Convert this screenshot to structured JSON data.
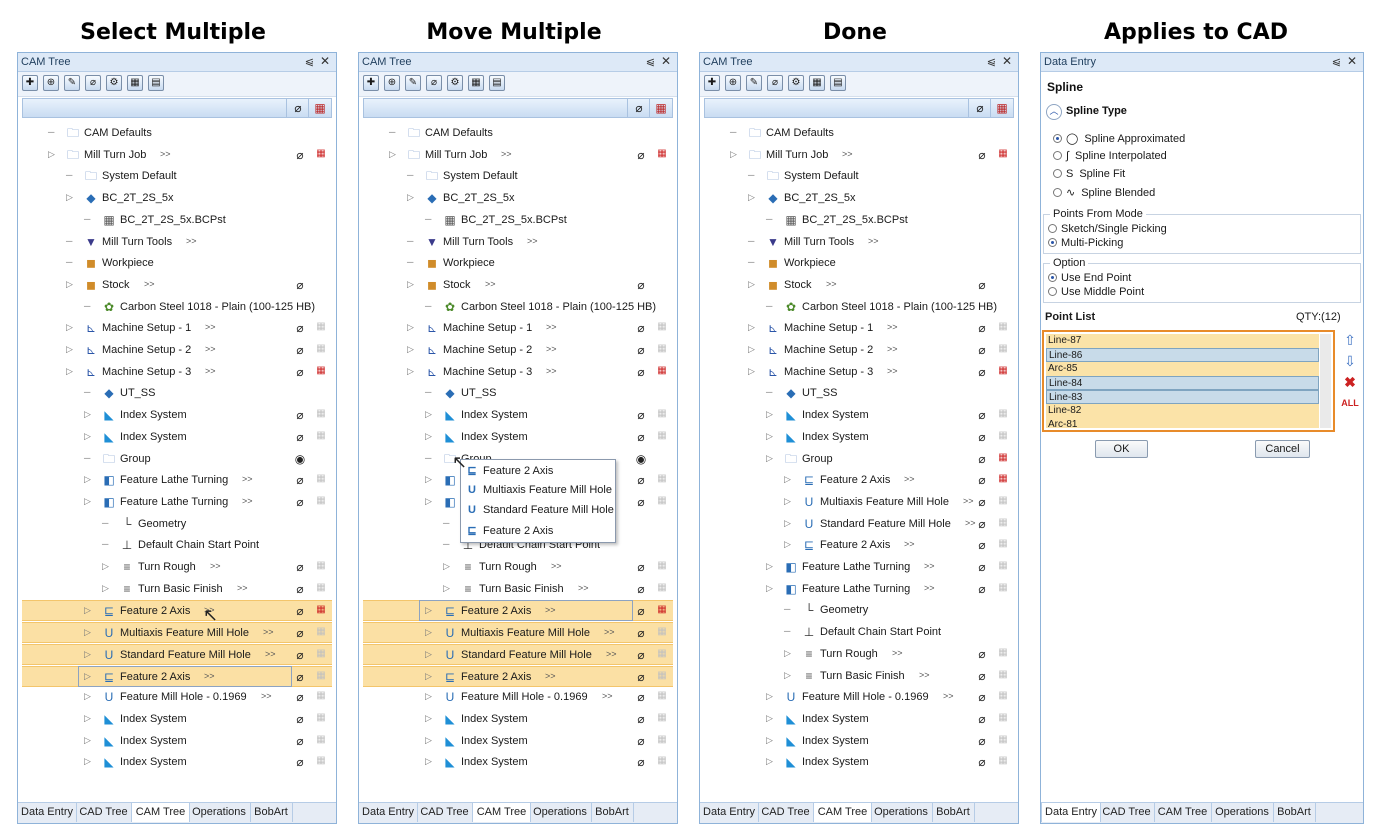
{
  "titles": {
    "p1": "Select Multiple",
    "p2": "Move Multiple",
    "p3": "Done",
    "p4": "Applies to CAD"
  },
  "window": {
    "cam_title": "CAM Tree",
    "pin": "⩿",
    "close": "✕"
  },
  "tabs": [
    "Data Entry",
    "CAD Tree",
    "CAM Tree",
    "Operations",
    "BobArt"
  ],
  "popup": {
    "items": [
      "Feature 2 Axis",
      "Multiaxis Feature Mill Hole",
      "Standard Feature Mill Hole",
      "Feature 2 Axis"
    ]
  },
  "tree1": [
    "CAM Defaults",
    "Mill Turn Job",
    "System Default",
    "BC_2T_2S_5x",
    "BC_2T_2S_5x.BCPst",
    "Mill Turn Tools",
    "Workpiece",
    "Stock",
    "Carbon Steel 1018 - Plain (100-125 HB)",
    "Machine Setup - 1",
    "Machine Setup - 2",
    "Machine Setup - 3",
    "UT_SS",
    "Index System",
    "Index System",
    "Group",
    "Feature Lathe Turning",
    "Feature Lathe Turning",
    "Geometry",
    "Default Chain Start Point",
    "Turn Rough",
    "Turn Basic Finish",
    "Feature 2 Axis",
    "Multiaxis Feature Mill Hole",
    "Standard Feature Mill Hole",
    "Feature 2 Axis",
    "Feature Mill Hole - 0.1969",
    "Index System",
    "Index System",
    "Index System"
  ],
  "tree2": [
    "CAM Defaults",
    "Mill Turn Job",
    "System Default",
    "BC_2T_2S_5x",
    "BC_2T_2S_5x.BCPst",
    "Mill Turn Tools",
    "Workpiece",
    "Stock",
    "Carbon Steel 1018 - Plain (100-125 HB)",
    "Machine Setup - 1",
    "Machine Setup - 2",
    "Machine Setup - 3",
    "UT_SS",
    "Index System",
    "Index System",
    "Group",
    "Feat",
    "Feat",
    "G",
    "Default Chain Start Point",
    "Turn Rough",
    "Turn Basic Finish",
    "Feature 2 Axis",
    "Multiaxis Feature Mill Hole",
    "Standard Feature Mill Hole",
    "Feature 2 Axis",
    "Feature Mill Hole - 0.1969",
    "Index System",
    "Index System",
    "Index System"
  ],
  "tree3": [
    "CAM Defaults",
    "Mill Turn Job",
    "System Default",
    "BC_2T_2S_5x",
    "BC_2T_2S_5x.BCPst",
    "Mill Turn Tools",
    "Workpiece",
    "Stock",
    "Carbon Steel 1018 - Plain (100-125 HB)",
    "Machine Setup - 1",
    "Machine Setup - 2",
    "Machine Setup - 3",
    "UT_SS",
    "Index System",
    "Index System",
    "Group",
    "Feature 2 Axis",
    "Multiaxis Feature Mill Hole",
    "Standard Feature Mill Hole",
    "Feature 2 Axis",
    "Feature Lathe Turning",
    "Feature Lathe Turning",
    "Geometry",
    "Default Chain Start Point",
    "Turn Rough",
    "Turn Basic Finish",
    "Feature Mill Hole - 0.1969",
    "Index System",
    "Index System",
    "Index System"
  ],
  "expand_marker": ">>",
  "data_entry": {
    "title": "Data Entry",
    "heading": "Spline",
    "spline_type_label": "Spline Type",
    "spline_options": [
      "Spline Approximated",
      "Spline Interpolated",
      "Spline Fit",
      "Spline Blended"
    ],
    "points_group": "Points From Mode",
    "points_options": [
      "Sketch/Single Picking",
      "Multi-Picking"
    ],
    "option_group": "Option",
    "option_options": [
      "Use End Point",
      "Use Middle Point"
    ],
    "point_list_label": "Point List",
    "qty": "QTY:(12)",
    "points": [
      "Line-87",
      "Line-86",
      "Arc-85",
      "Line-84",
      "Line-83",
      "Line-82",
      "Arc-81"
    ],
    "ok": "OK",
    "cancel": "Cancel"
  },
  "colors": {
    "selection": "#fbe0a4",
    "accent_orange": "#e88b2a",
    "panel_border": "#8fb3d9"
  }
}
